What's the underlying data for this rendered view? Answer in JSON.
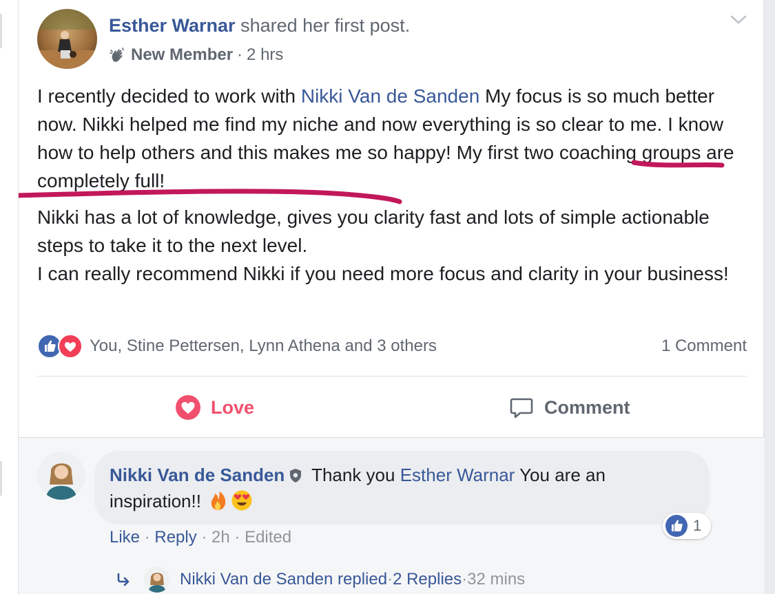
{
  "post": {
    "author": "Esther Warnar",
    "action": "shared her first post.",
    "member_badge": "New Member",
    "separator": "·",
    "time": "2 hrs",
    "text_before_mention": "I recently decided to work with ",
    "mention": "Nikki Van de Sanden",
    "text_after_mention": " My focus is so much better now. Nikki helped me find my niche and now everything is so clear to me. I know how to help others and this makes me so happy! My first two coaching groups are completely full!",
    "paragraph2": "Nikki has a lot of knowledge, gives you clarity fast and lots of simple actionable steps to take it to the next level.",
    "paragraph3": "I can really recommend Nikki if you need more focus and clarity in your business!",
    "underline_color": "#c2185b"
  },
  "reactions": {
    "names": "You, Stine Pettersen, Lynn Athena and 3 others",
    "comment_count": "1 Comment",
    "like_color": "#4267b2",
    "love_color": "#f33e58"
  },
  "actions": {
    "love_label": "Love",
    "comment_label": "Comment"
  },
  "comment": {
    "author": "Nikki Van de Sanden",
    "text_before": " Thank you ",
    "mention": "Esther Warnar",
    "text_after": " You are an inspiration!! ",
    "emojis": [
      "fire-emoji",
      "heart-eyes-emoji"
    ],
    "like_count": "1",
    "like_label": "Like",
    "reply_label": "Reply",
    "time": "2h",
    "edited": "Edited",
    "dot": " · "
  },
  "replies": {
    "summary": "Nikki Van de Sanden replied",
    "count_label": "2 Replies",
    "time": "32 mins"
  }
}
